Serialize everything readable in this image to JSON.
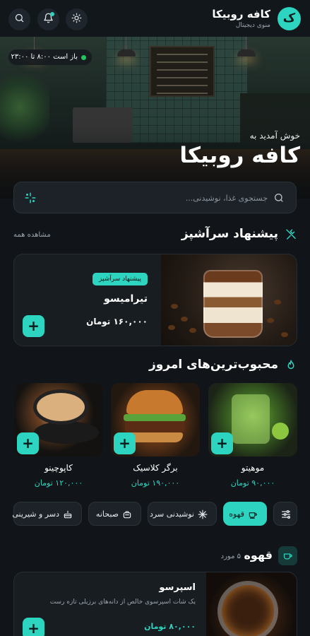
{
  "header": {
    "logo_letter": "ک",
    "brand_name": "کافه روبیکا",
    "brand_subtitle": "منوی دیجیتال",
    "icons": [
      "theme-sun-icon",
      "bell-icon",
      "search-icon"
    ]
  },
  "hero": {
    "status": "باز است ۸:۰۰ تا ۲۳:۰۰",
    "welcome": "خوش آمدید به",
    "title": "کافه روبیکا"
  },
  "search": {
    "placeholder": "جستجوی غذا، نوشیدنی..."
  },
  "chef": {
    "section_title": "پیشنهاد سرآشپز",
    "view_all": "مشاهده همه",
    "badge": "پیشنهاد سرآشپز",
    "item_name": "تیرامیسو",
    "price": "۱۶۰,۰۰۰ تومان"
  },
  "popular": {
    "section_title": "محبوب‌ترین‌های امروز",
    "items": [
      {
        "name": "موهیتو",
        "price": "۹۰,۰۰۰ تومان"
      },
      {
        "name": "برگر کلاسیک",
        "price": "۱۹۰,۰۰۰ تومان"
      },
      {
        "name": "کاپوچینو",
        "price": "۱۲۰,۰۰۰ تومان"
      }
    ]
  },
  "categories": [
    {
      "label": "قهوه",
      "icon": "coffee-cup-icon",
      "active": true
    },
    {
      "label": "نوشیدنی سرد",
      "icon": "snowflake-icon",
      "active": false
    },
    {
      "label": "صبحانه",
      "icon": "toaster-icon",
      "active": false
    },
    {
      "label": "دسر و شیرینی",
      "icon": "cake-icon",
      "active": false
    }
  ],
  "coffee_list": {
    "title": "قهوه",
    "count": "۵ مورد",
    "items": [
      {
        "name": "اسپرسو",
        "description": "یک شات اسپرسوی خالص از دانه‌های برزیلی تازه رست",
        "price": "۸۰,۰۰۰ تومان"
      }
    ]
  },
  "colors": {
    "accent": "#2dd4bf",
    "background": "#11151a",
    "card": "#181d22",
    "open_status": "#22c55e"
  }
}
